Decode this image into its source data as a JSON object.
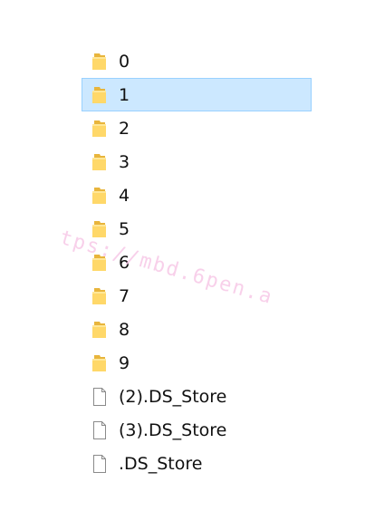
{
  "items": [
    {
      "name": "0",
      "type": "folder",
      "icon": "folder-icon",
      "selected": false
    },
    {
      "name": "1",
      "type": "folder",
      "icon": "folder-icon",
      "selected": true
    },
    {
      "name": "2",
      "type": "folder",
      "icon": "folder-icon",
      "selected": false
    },
    {
      "name": "3",
      "type": "folder",
      "icon": "folder-icon",
      "selected": false
    },
    {
      "name": "4",
      "type": "folder",
      "icon": "folder-icon",
      "selected": false
    },
    {
      "name": "5",
      "type": "folder",
      "icon": "folder-icon",
      "selected": false
    },
    {
      "name": "6",
      "type": "folder",
      "icon": "folder-icon",
      "selected": false
    },
    {
      "name": "7",
      "type": "folder",
      "icon": "folder-icon",
      "selected": false
    },
    {
      "name": "8",
      "type": "folder",
      "icon": "folder-icon",
      "selected": false
    },
    {
      "name": "9",
      "type": "folder",
      "icon": "folder-icon",
      "selected": false
    },
    {
      "name": "(2).DS_Store",
      "type": "file",
      "icon": "file-icon",
      "selected": false
    },
    {
      "name": "(3).DS_Store",
      "type": "file",
      "icon": "file-icon",
      "selected": false
    },
    {
      "name": ".DS_Store",
      "type": "file",
      "icon": "file-icon",
      "selected": false
    }
  ],
  "watermark": "tps://mbd.6pen.a",
  "colors": {
    "selection_bg": "#cce8ff",
    "selection_border": "#99d1ff",
    "folder_body": "#ffd869",
    "folder_back": "#e8b53c",
    "file_outline": "#8a8a8a",
    "watermark": "#f7c8e7"
  }
}
